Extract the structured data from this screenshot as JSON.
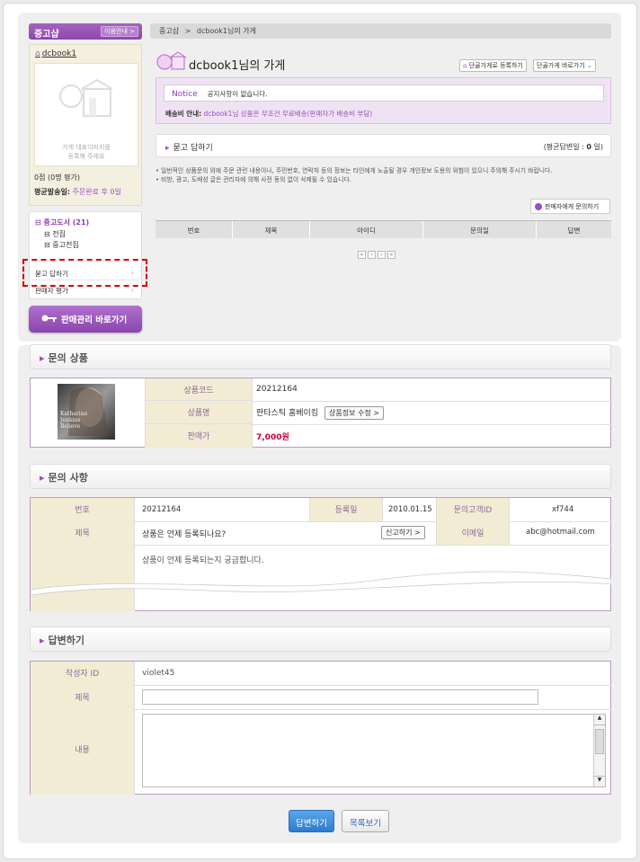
{
  "sidebar": {
    "title": "중고샵",
    "guide_label": "이용안내 >",
    "shop_name": "dcbook1",
    "image_msg_1": "가게 대표이미지를",
    "image_msg_2": "등록해 주세요",
    "rating": "0점 (0명 평가)",
    "delivery_label": "평균발송일:",
    "delivery_value": "주문완료 후 0일",
    "category_main": "중고도서 (21)",
    "category_sub1": "전집",
    "category_sub2": "중고전집",
    "menu_qa": "묻고 답하기",
    "menu_review": "판매자 평가",
    "manage_button": "판매관리 바로가기"
  },
  "breadcrumb": {
    "root": "중고샵",
    "sep": ">",
    "current": "dcbook1님의 가게"
  },
  "store": {
    "title": "dcbook1님의 가게",
    "register_button": "단골가게로 등록하기",
    "goto_select": "단골가게 바로가기"
  },
  "notice": {
    "label": "Notice",
    "text": "공지사항이 없습니다.",
    "ship_label": "배송비 안내:",
    "ship_text": "dcbook1님 상품은 무조건 무료배송(판매자가 배송비 부담)"
  },
  "qa": {
    "title": "묻고 답하기",
    "avg_label": "(평균답변일 : ",
    "avg_value": "0",
    "avg_unit": " 일)",
    "rule1": "• 일반적인 상품문의 외에 주문 관련 내용이나, 주민번호, 연락처 등의 정보는 타인에게 노출될 경우 개인정보 도용의 위험이 있으니 주의해 주시기 바랍니다.",
    "rule2": "• 비방, 광고, 도배성 글은 관리자에 의해 사전 동의 없이 삭제될 수 있습니다.",
    "ask_button": "판매자에게 문의하기",
    "columns": [
      "번호",
      "제목",
      "아이디",
      "문의일",
      "답변"
    ]
  },
  "pager": [
    "«",
    "‹",
    "›",
    "»"
  ],
  "product": {
    "section_title": "문의 상품",
    "code_label": "상품코드",
    "code_value": "20212164",
    "name_label": "상품명",
    "name_value": "판타스틱 홈베이킹",
    "edit_button": "상품정보 수정 >",
    "price_label": "판매가",
    "price_value": "7,000원",
    "thumb_text": "Katharine Jenkins Believe"
  },
  "inquiry": {
    "section_title": "문의 사항",
    "no_label": "번호",
    "no_value": "20212164",
    "date_label": "등록일",
    "date_value": "2010.01.15",
    "customer_label": "문의고객ID",
    "customer_value": "xf744",
    "subject_label": "제목",
    "subject_value": "상품은 언제 등록되나요?",
    "report_button": "신고하기 >",
    "email_label": "이메일",
    "email_value": "abc@hotmail.com",
    "body": "상품이 언제 등록되는지 궁금합니다."
  },
  "reply": {
    "section_title": "답변하기",
    "author_label": "작성자 ID",
    "author_value": "violet45",
    "subject_label": "제목",
    "subject_value": "",
    "content_label": "내용",
    "content_value": ""
  },
  "actions": {
    "submit": "답변하기",
    "list": "목록보기"
  },
  "colors": {
    "accent": "#9a4fc0",
    "price": "#c8003c",
    "label_bg": "#f3ecd4"
  }
}
